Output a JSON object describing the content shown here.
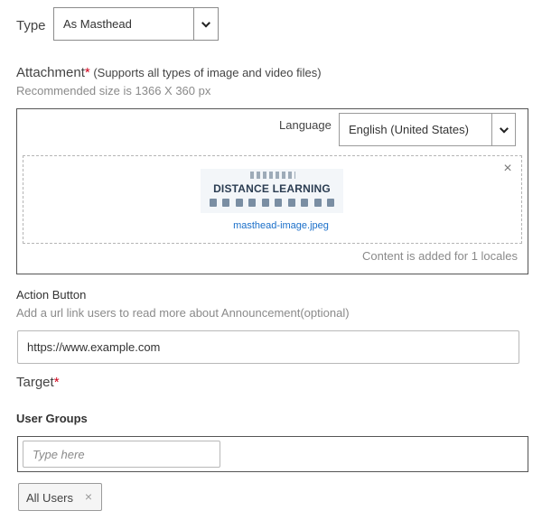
{
  "type": {
    "label": "Type",
    "selected": "As Masthead"
  },
  "attachment": {
    "label": "Attachment",
    "required_mark": "*",
    "note": " (Supports all types of image and video files)",
    "hint": "Recommended size is 1366 X 360 px",
    "language_label": "Language",
    "language_selected": "English (United States)",
    "thumbnail_title": "DISTANCE LEARNING",
    "file_name": "masthead-image.jpeg",
    "close_glyph": "×",
    "locale_note": "Content is added for 1 locales"
  },
  "action": {
    "label": "Action Button",
    "hint": "Add a url link users to read more about Announcement(optional)",
    "url_value": "https://www.example.com"
  },
  "target": {
    "label": "Target",
    "required_mark": "*",
    "groups_label": "User Groups",
    "groups_placeholder": "Type here",
    "tags": [
      {
        "label": "All Users",
        "remove_glyph": "×"
      }
    ]
  }
}
